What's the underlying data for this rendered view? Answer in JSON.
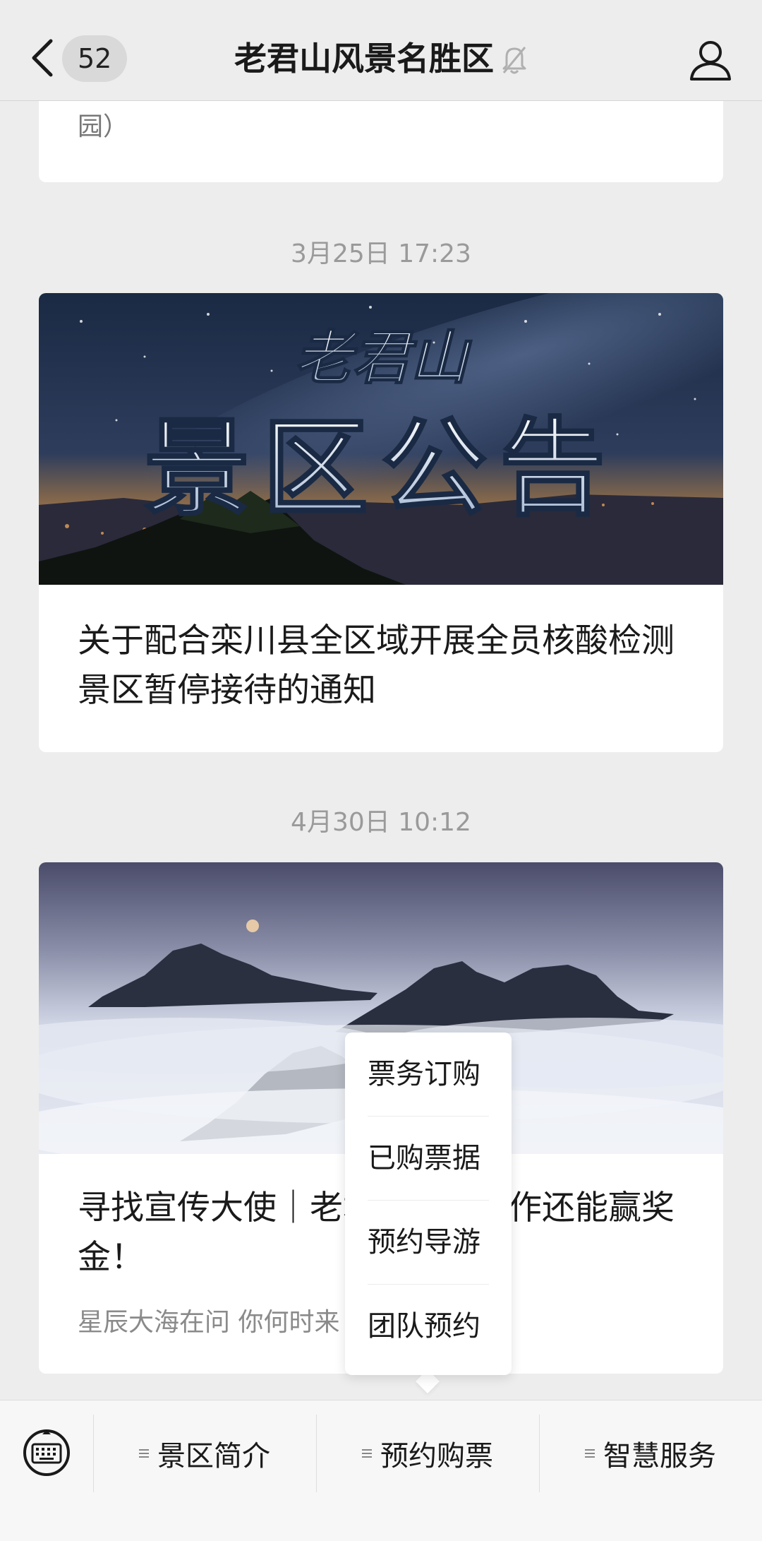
{
  "header": {
    "unread_count": "52",
    "title": "老君山风景名胜区"
  },
  "feed": {
    "prev_card_snippet": "园）",
    "articles": [
      {
        "timestamp": "3月25日 17:23",
        "cover_text_small": "老君山",
        "cover_text_large": "景区公告",
        "title": "关于配合栾川县全区域开展全员核酸检测景区暂停接待的通知"
      },
      {
        "timestamp": "4月30日 10:12",
        "title": "寻找宣传大使｜老君山视频创作还能赢奖金！",
        "subtitle": "星辰大海在问 你何时来"
      }
    ]
  },
  "popup_menu": {
    "items": [
      "票务订购",
      "已购票据",
      "预约导游",
      "团队预约"
    ]
  },
  "bottom_menu": {
    "tabs": [
      "景区简介",
      "预约购票",
      "智慧服务"
    ]
  },
  "colors": {
    "background": "#ededed",
    "card": "#ffffff",
    "timestamp": "#9a9a9a"
  }
}
